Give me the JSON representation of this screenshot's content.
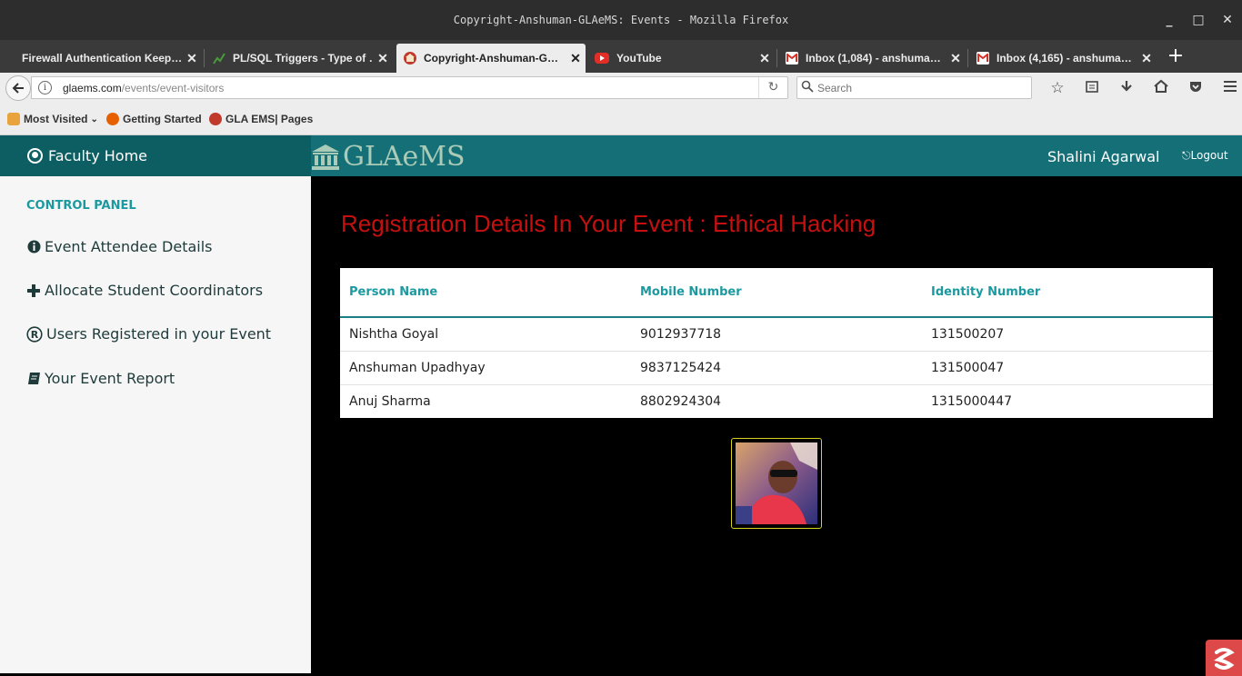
{
  "window": {
    "title": "Copyright-Anshuman-GLAeMS: Events - Mozilla Firefox",
    "controls": {
      "minimize": "_",
      "maximize": "□",
      "close": "✕"
    }
  },
  "tabs": [
    {
      "label": "Firewall Authentication Keep…",
      "icon": "none",
      "close": "✕"
    },
    {
      "label": "PL/SQL Triggers - Type of …",
      "icon": "chart-favicon",
      "close": "✕"
    },
    {
      "label": "Copyright-Anshuman-G…",
      "icon": "glaems-favicon",
      "close": "✕",
      "active": true
    },
    {
      "label": "YouTube",
      "icon": "youtube-favicon",
      "close": "✕"
    },
    {
      "label": "Inbox (1,084) - anshuma…",
      "icon": "gmail-favicon",
      "close": "✕"
    },
    {
      "label": "Inbox (4,165) - anshuma…",
      "icon": "gmail-favicon",
      "close": "✕"
    }
  ],
  "newtab": "+",
  "navbar": {
    "url_domain": "glaems.com",
    "url_path": "/events/event-visitors",
    "search_placeholder": "Search"
  },
  "bookmarks": [
    {
      "label": "Most Visited",
      "icon": "folder-icon",
      "dropdown": "⌄"
    },
    {
      "label": "Getting Started",
      "icon": "firefox-icon"
    },
    {
      "label": "GLA EMS| Pages",
      "icon": "glaems-icon"
    }
  ],
  "header": {
    "faculty_home": "Faculty Home",
    "brand": "GLAeMS",
    "user": "Shalini Agarwal",
    "logout": "Logout"
  },
  "sidebar": {
    "title": "CONTROL PANEL",
    "items": [
      {
        "label": "Event Attendee Details",
        "icon": "info-circle-icon"
      },
      {
        "label": "Allocate Student Coordinators",
        "icon": "plus-icon"
      },
      {
        "label": "Users Registered in your Event",
        "icon": "registered-icon"
      },
      {
        "label": "Your Event Report",
        "icon": "book-icon"
      }
    ]
  },
  "main": {
    "title": "Registration Details In Your Event : Ethical Hacking",
    "columns": [
      "Person Name",
      "Mobile Number",
      "Identity Number"
    ],
    "rows": [
      [
        "Nishtha Goyal",
        "9012937718",
        "131500207"
      ],
      [
        "Anshuman Upadhyay",
        "9837125424",
        "131500047"
      ],
      [
        "Anuj Sharma",
        "8802924304",
        "1315000447"
      ]
    ]
  },
  "colors": {
    "header_dark": "#0c5e63",
    "header": "#156f77",
    "accent": "#1a9aa0",
    "title_red": "#c61010"
  }
}
